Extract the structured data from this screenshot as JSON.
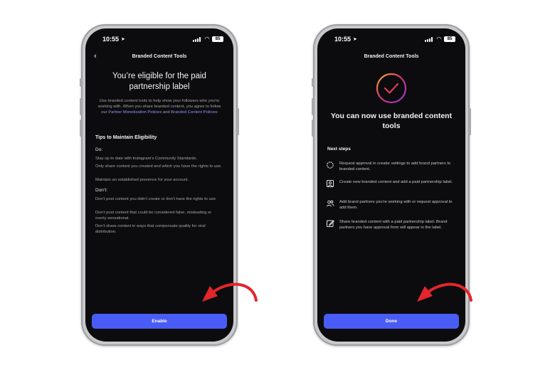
{
  "left_phone": {
    "status": {
      "time": "10:55",
      "battery": "85"
    },
    "nav_title": "Branded Content Tools",
    "heading": "You’re eligible for the paid partnership label",
    "intro_before": "Use branded content tools to help show your followers who you’re working with. When you share branded content, you agree to follow our ",
    "link_monetization": "Partner Monetization Policies",
    "intro_and": " and ",
    "link_branded": "Branded Content Policies",
    "tips_title": "Tips to Maintain Eligibility",
    "do_label": "Do:",
    "do_items": [
      "Stay up to date with Instagram’s Community Standards.",
      "Only share content you created and which you have the rights to use.",
      "Maintain an established presence for your account."
    ],
    "dont_label": "Don’t:",
    "dont_items": [
      "Don’t post content you didn’t create or don’t have the rights to use.",
      "Don’t post content that could be considered false, misleading or overly sensational.",
      "Don’t share content in ways that compensate quality for viral distribution."
    ],
    "button_label": "Enable"
  },
  "right_phone": {
    "status": {
      "time": "10:55",
      "battery": "85"
    },
    "nav_title": "Branded Content Tools",
    "heading": "You can now use branded content tools",
    "next_steps_title": "Next steps",
    "steps": [
      {
        "icon": "badge-icon",
        "text": "Request approval in creator settings to add brand partners to branded content."
      },
      {
        "icon": "image-post-icon",
        "text": "Create new branded content and add a paid partnership label."
      },
      {
        "icon": "people-icon",
        "text": "Add brand partners you’re working with or request approval to add them."
      },
      {
        "icon": "edit-icon",
        "text": "Share branded content with a paid partnership label. Brand partners you have approval from will appear in the label."
      }
    ],
    "button_label": "Done"
  },
  "colors": {
    "accent_button": "#4a5cf6",
    "link": "#8f95ff",
    "arrow": "#e3262c",
    "screen_bg": "#0c0c0e"
  }
}
